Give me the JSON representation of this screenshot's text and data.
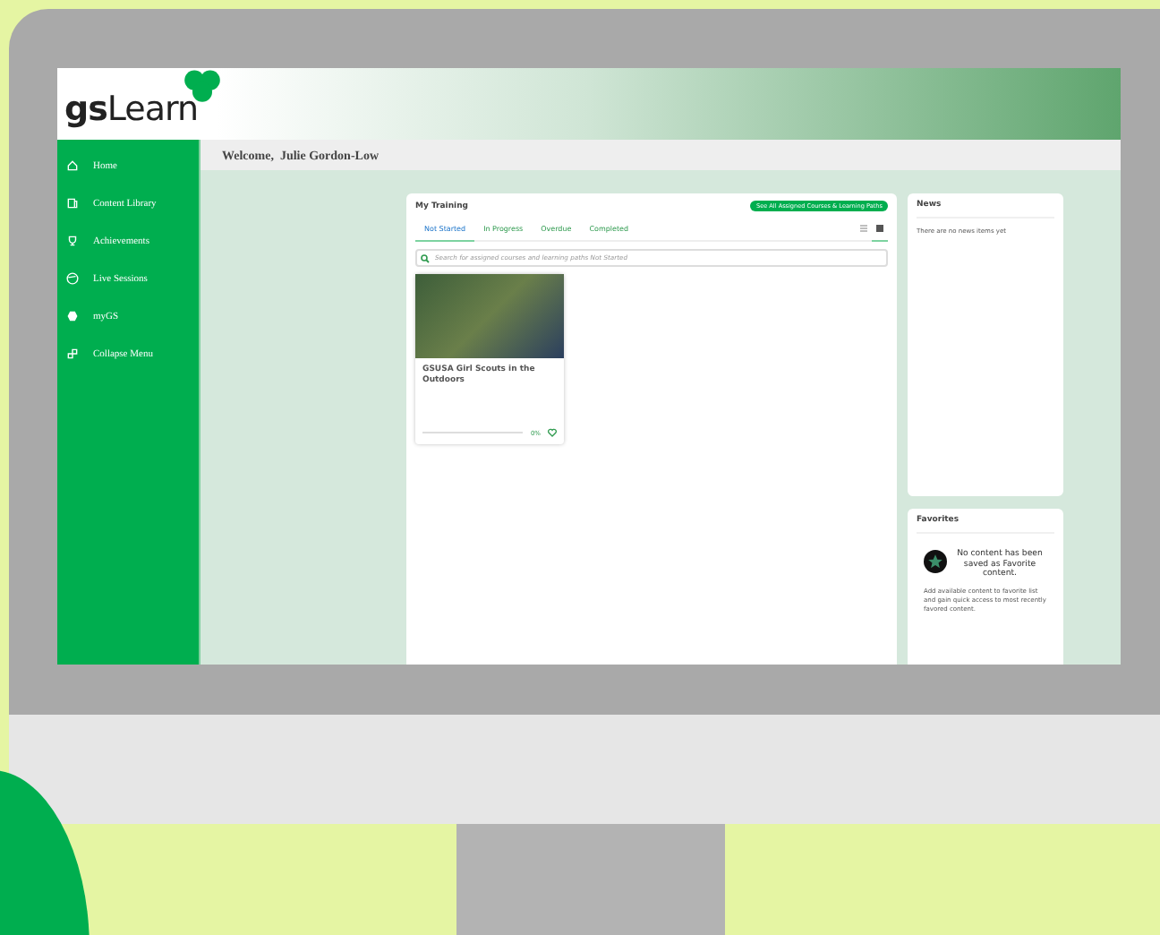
{
  "header": {
    "logo": "gsLearn"
  },
  "sidebar": {
    "items": [
      {
        "label": "Home"
      },
      {
        "label": "Content Library"
      },
      {
        "label": "Achievements"
      },
      {
        "label": "Live Sessions"
      },
      {
        "label": "myGS"
      },
      {
        "label": "Collapse Menu"
      }
    ]
  },
  "welcome": "Welcome,  Julie Gordon-Low",
  "training": {
    "title": "My Training",
    "button": "See All Assigned Courses & Learning Paths",
    "tabs": [
      {
        "label": "Not Started",
        "selected": true
      },
      {
        "label": "In Progress",
        "selected": false
      },
      {
        "label": "Overdue",
        "selected": false
      },
      {
        "label": "Completed",
        "selected": false
      }
    ],
    "views": [
      {
        "kind": "list",
        "selected": false
      },
      {
        "kind": "grid",
        "selected": true
      }
    ],
    "search": {
      "placeholder": "Search for assigned courses and learning paths Not Started"
    },
    "courses": [
      {
        "title": "GSUSA Girl Scouts in the Outdoors",
        "level": 0,
        "progress": "0%"
      }
    ]
  },
  "news": {
    "title": "News",
    "message": "There are no news items yet"
  },
  "favorites": {
    "title": "Favorites",
    "heading": "No content has been saved as Favorite content.",
    "text": "Add available content to favorite list and gain quick access to most recently favored content."
  }
}
